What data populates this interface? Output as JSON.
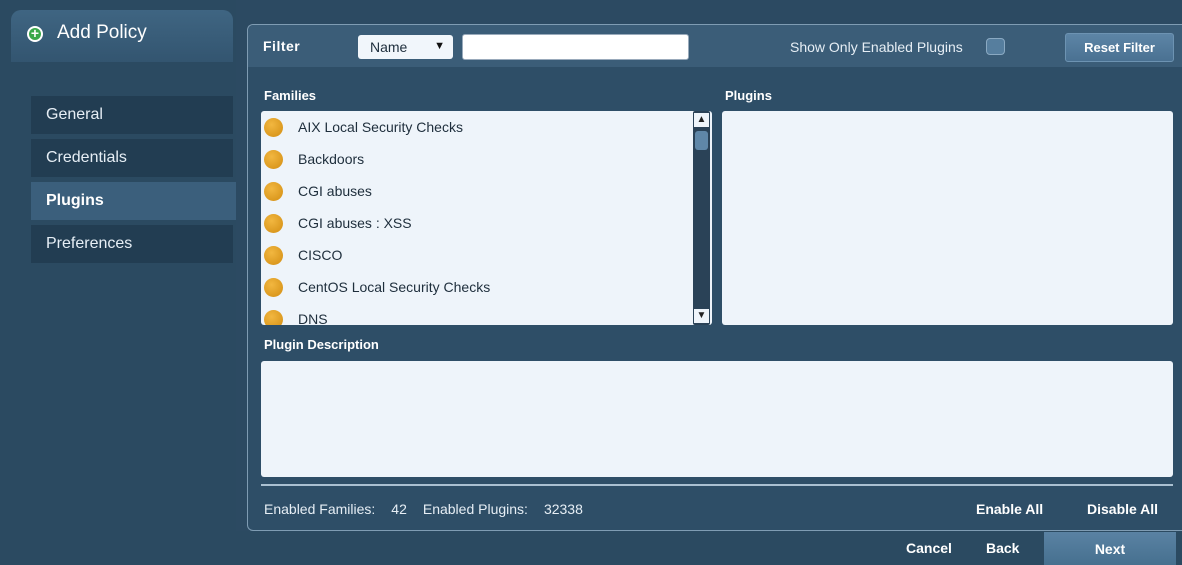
{
  "sidebar": {
    "header": "Add Policy",
    "items": [
      {
        "label": "General"
      },
      {
        "label": "Credentials"
      },
      {
        "label": "Plugins"
      },
      {
        "label": "Preferences"
      }
    ]
  },
  "filter": {
    "label": "Filter",
    "select_value": "Name",
    "input_value": "",
    "show_enabled_label": "Show Only Enabled Plugins",
    "reset_label": "Reset Filter"
  },
  "families": {
    "label": "Families",
    "items": [
      "AIX Local Security Checks",
      "Backdoors",
      "CGI abuses",
      "CGI abuses : XSS",
      "CISCO",
      "CentOS Local Security Checks",
      "DNS"
    ]
  },
  "plugins": {
    "label": "Plugins"
  },
  "description": {
    "label": "Plugin Description"
  },
  "stats": {
    "families_label": "Enabled Families:",
    "families_count": "42",
    "plugins_label": "Enabled Plugins:",
    "plugins_count": "32338"
  },
  "actions": {
    "enable_all": "Enable All",
    "disable_all": "Disable All",
    "cancel": "Cancel",
    "back": "Back",
    "next": "Next"
  },
  "colors": {
    "background": "#2c4a62",
    "panel": "#eef4fa",
    "family_dot": "#e3a52a",
    "add_icon": "#3aa84a"
  }
}
